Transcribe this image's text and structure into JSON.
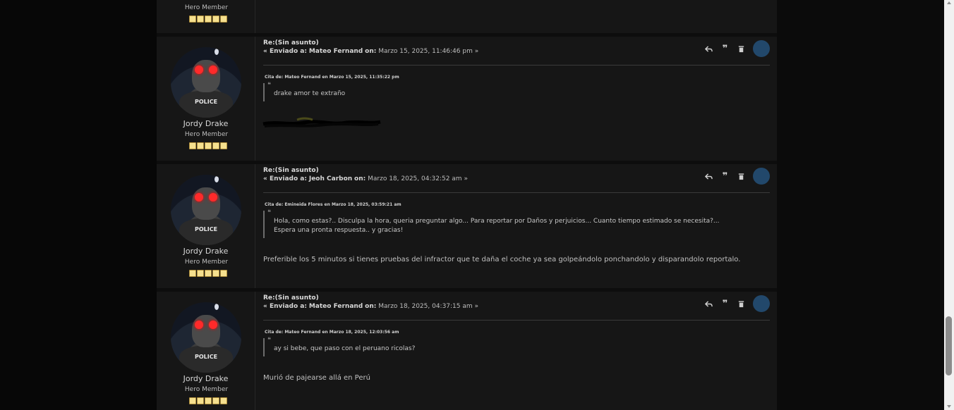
{
  "top_post": {
    "rank": "Hero Member",
    "stars": 5
  },
  "posts": [
    {
      "author": "Jordy Drake",
      "rank": "Hero Member",
      "stars": 5,
      "avatar_text": "POLICE",
      "subject": "Re:(Sin asunto)",
      "meta_prefix": "« Enviado a:",
      "recipient": "Mateo Fernand",
      "on_label": "on:",
      "date": "Marzo 15, 2025, 11:46:46 pm",
      "meta_suffix": "»",
      "quote_cite": "Cita de: Mateo Fernand en Marzo 15, 2025, 11:35:22 pm",
      "quote_text": "drake amor te extraño",
      "reply_text": "",
      "has_scribble": true
    },
    {
      "author": "Jordy Drake",
      "rank": "Hero Member",
      "stars": 5,
      "avatar_text": "POLICE",
      "subject": "Re:(Sin asunto)",
      "meta_prefix": "« Enviado a:",
      "recipient": "Jeoh Carbon",
      "on_label": "on:",
      "date": "Marzo 18, 2025, 04:32:52 am",
      "meta_suffix": "»",
      "quote_cite": "Cita de: Emineida Flores en Marzo 18, 2025, 03:59:21 am",
      "quote_text": "Hola, como estas?.. Disculpa la hora, queria preguntar algo... Para reportar por Daños y perjuicios... Cuanto tiempo estimado se necesita?... Espera una pronta respuesta.. y gracias!",
      "reply_text": "Preferible los 5 minutos si tienes pruebas del infractor que te daña el coche ya sea golpeándolo ponchandolo y disparandolo reportalo.",
      "has_scribble": false
    },
    {
      "author": "Jordy Drake",
      "rank": "Hero Member",
      "stars": 5,
      "avatar_text": "POLICE",
      "subject": "Re:(Sin asunto)",
      "meta_prefix": "« Enviado a:",
      "recipient": "Mateo Fernand",
      "on_label": "on:",
      "date": "Marzo 18, 2025, 04:37:15 am",
      "meta_suffix": "»",
      "quote_cite": "Cita de: Mateo Fernand en Marzo 18, 2025, 12:03:56 am",
      "quote_text": "ay si bebe, que paso con el peruano ricolas?",
      "reply_text": "Murió de pajearse allá en Perú",
      "has_scribble": false
    }
  ],
  "actions": [
    {
      "name": "reply-icon"
    },
    {
      "name": "quote-icon"
    },
    {
      "name": "delete-icon"
    }
  ],
  "colors": {
    "page_bg": "#070707",
    "post_bg": "#161616",
    "star_fill": "#f5e08f",
    "avatar_eyes": "#ff2a2a",
    "action_circle": "#22486b"
  },
  "scroll_position": 0.88
}
